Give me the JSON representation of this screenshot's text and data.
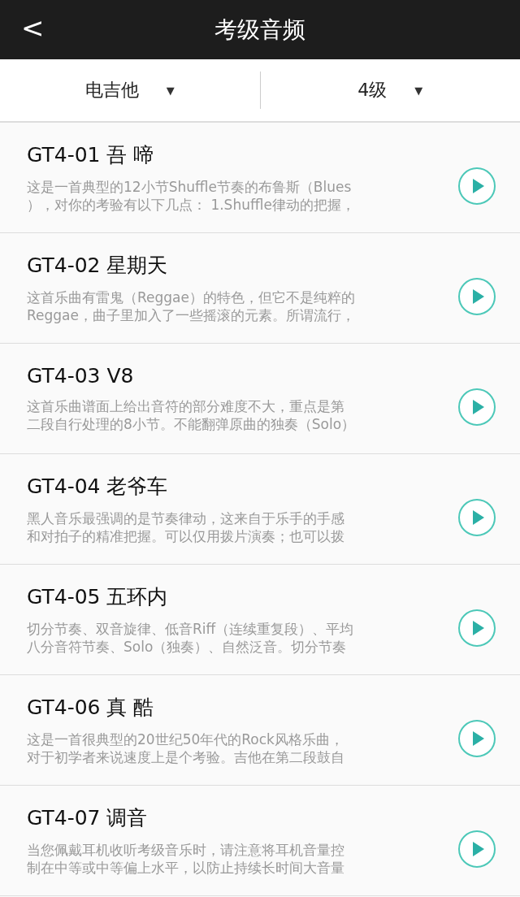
{
  "header": {
    "back": "<",
    "title": "考级音频"
  },
  "filters": [
    {
      "label": "电吉他",
      "caret": "▼"
    },
    {
      "label": "4级",
      "caret": "▼"
    }
  ],
  "tracks": [
    {
      "title": "GT4-01 吾 啼",
      "lines": [
        "这是一首典型的12小节Shuffle节奏的布鲁斯（Blues",
        "），对你的考验有以下几点： 1.Shuffle律动的把握，"
      ]
    },
    {
      "title": "GT4-02 星期天",
      "lines": [
        "这首乐曲有雷鬼（Reggae）的特色，但它不是纯粹的",
        "Reggae，曲子里加入了一些摇滚的元素。所谓流行，"
      ]
    },
    {
      "title": "GT4-03 V8",
      "lines": [
        "这首乐曲谱面上给出音符的部分难度不大，重点是第",
        "二段自行处理的8小节。不能翻弹原曲的独奏（Solo）"
      ]
    },
    {
      "title": "GT4-04 老爷车",
      "lines": [
        "黑人音乐最强调的是节奏律动，这来自于乐手的手感",
        "和对拍子的精准把握。可以仅用拨片演奏；也可以拨"
      ]
    },
    {
      "title": "GT4-05 五环内",
      "lines": [
        "切分节奏、双音旋律、低音Riff（连续重复段）、平均",
        "八分音符节奏、Solo（独奏）、自然泛音。切分节奏"
      ]
    },
    {
      "title": "GT4-06 真 酷",
      "lines": [
        "这是一首很典型的20世纪50年代的Rock风格乐曲，",
        "对于初学者来说速度上是个考验。吉他在第二段鼓自"
      ]
    },
    {
      "title": "GT4-07 调音",
      "lines": [
        "当您佩戴耳机收听考级音乐时，请注意将耳机音量控",
        "制在中等或中等偏上水平，以防止持续长时间大音量"
      ]
    }
  ]
}
